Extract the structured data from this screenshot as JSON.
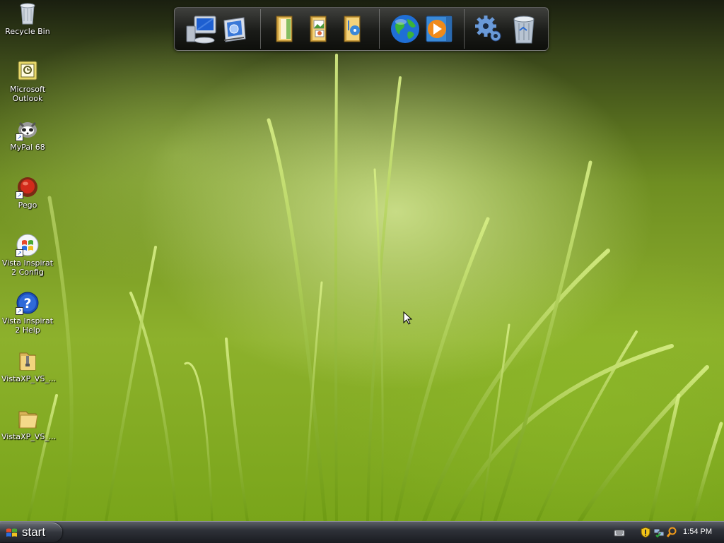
{
  "desktop": {
    "icons": [
      {
        "label": "Recycle Bin",
        "icon": "recycle-bin-icon"
      },
      {
        "label": "Microsoft Outlook",
        "icon": "outlook-icon"
      },
      {
        "label": "MyPal 68",
        "icon": "mypal-icon"
      },
      {
        "label": "Pego",
        "icon": "pego-icon"
      },
      {
        "label": "Vista Inspirat 2 Config",
        "icon": "windows-logo-icon"
      },
      {
        "label": "Vista Inspirat 2 Help",
        "icon": "help-icon"
      },
      {
        "label": "VistaXP_VS_...",
        "icon": "zip-folder-icon"
      },
      {
        "label": "VistaXP_VS_...",
        "icon": "folder-icon"
      }
    ]
  },
  "dock": {
    "items": [
      {
        "icon": "my-computer-icon"
      },
      {
        "icon": "control-panel-icon"
      },
      {
        "icon": "documents-folder-icon"
      },
      {
        "icon": "pictures-folder-icon"
      },
      {
        "icon": "music-folder-icon"
      },
      {
        "icon": "internet-explorer-globe-icon"
      },
      {
        "icon": "media-player-icon"
      },
      {
        "icon": "settings-gears-icon"
      },
      {
        "icon": "dock-recycle-bin-icon"
      }
    ]
  },
  "taskbar": {
    "start_label": "start",
    "clock": "1:54 PM",
    "tray_icons": [
      "keyboard-icon",
      "security-shield-icon",
      "network-icon",
      "search-icon"
    ]
  },
  "colors": {
    "taskbar": "#1a1c21",
    "wallpaper_green": "#8db12c",
    "label_text": "#ffffff"
  }
}
